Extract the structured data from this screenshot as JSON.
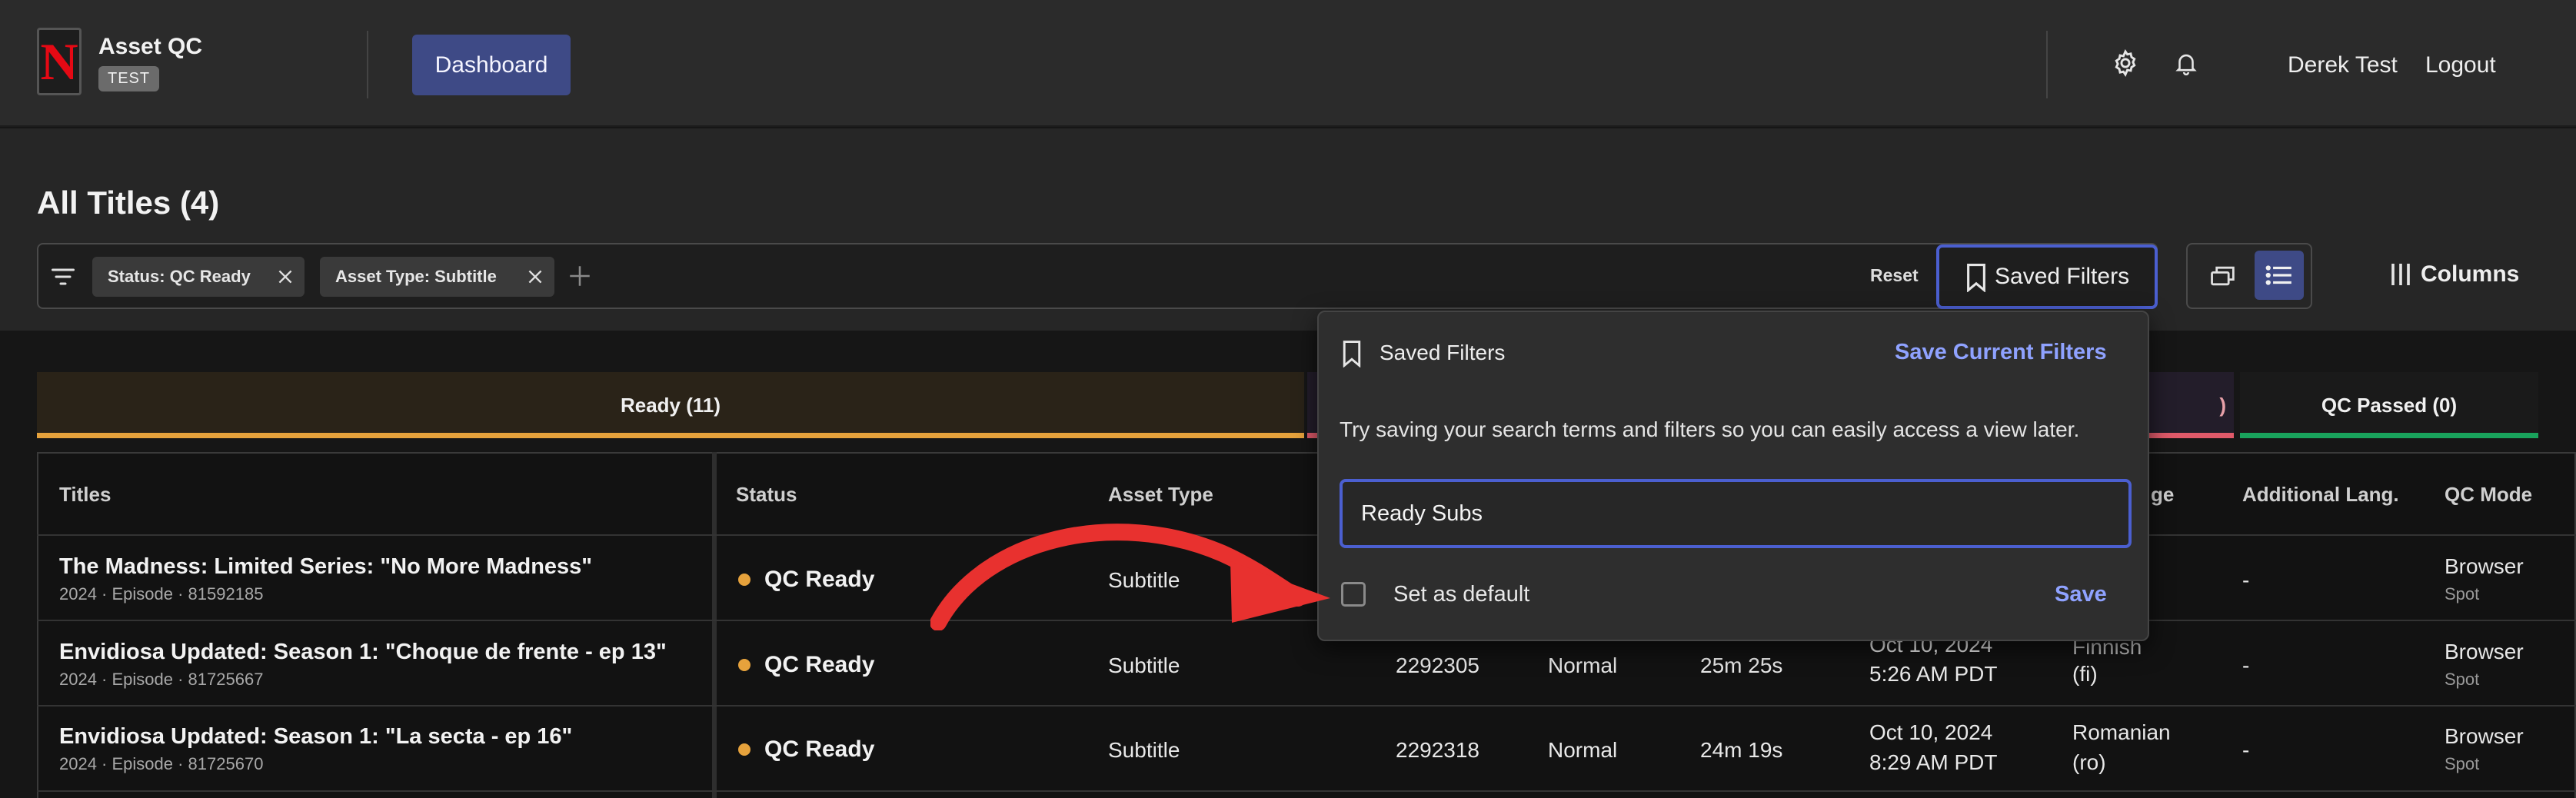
{
  "app": {
    "title": "Asset QC",
    "env_badge": "TEST",
    "logo_letter": "N",
    "brand_color": "#e50914"
  },
  "nav": {
    "dashboard_label": "Dashboard",
    "user_name": "Derek Test",
    "logout_label": "Logout",
    "icons": [
      "gear-icon",
      "bell-icon"
    ]
  },
  "page": {
    "title": "All Titles (4)"
  },
  "filters": {
    "chips": [
      {
        "label": "Status: QC Ready"
      },
      {
        "label": "Asset Type: Subtitle"
      }
    ],
    "reset_label": "Reset",
    "saved_filters_label": "Saved Filters",
    "columns_label": "Columns"
  },
  "status_tabs": [
    {
      "label": "Ready (11)",
      "color": "#e6a23c"
    },
    {
      "label": ")",
      "color": "#e05a6a"
    },
    {
      "label": "QC Passed (0)",
      "color": "#19a35c"
    }
  ],
  "table": {
    "headers": [
      "Titles",
      "Status",
      "Asset Type",
      "ge",
      "Additional Lang.",
      "QC Mode"
    ],
    "rows": [
      {
        "title": "The Madness: Limited Series: \"No More Madness\"",
        "meta": "2024 · Episode · 81592185",
        "status": "QC Ready",
        "asset_type": "Subtitle",
        "id": "",
        "priority": "",
        "duration": "",
        "date": "",
        "time": "",
        "language": "",
        "language_code": "",
        "additional_lang": "-",
        "qc_mode": "Browser",
        "qc_mode_sub": "Spot"
      },
      {
        "title": "Envidiosa Updated: Season 1: \"Choque de frente - ep 13\"",
        "meta": "2024 · Episode · 81725667",
        "status": "QC Ready",
        "asset_type": "Subtitle",
        "id": "2292305",
        "priority": "Normal",
        "duration": "25m 25s",
        "date": "Oct 10, 2024",
        "time": "5:26 AM PDT",
        "language": "Finnish",
        "language_code": "(fi)",
        "additional_lang": "-",
        "qc_mode": "Browser",
        "qc_mode_sub": "Spot"
      },
      {
        "title": "Envidiosa Updated: Season 1: \"La secta - ep 16\"",
        "meta": "2024 · Episode · 81725670",
        "status": "QC Ready",
        "asset_type": "Subtitle",
        "id": "2292318",
        "priority": "Normal",
        "duration": "24m 19s",
        "date": "Oct 10, 2024",
        "time": "8:29 AM PDT",
        "language": "Romanian",
        "language_code": "(ro)",
        "additional_lang": "-",
        "qc_mode": "Browser",
        "qc_mode_sub": "Spot"
      }
    ]
  },
  "saved_filters_popover": {
    "title": "Saved Filters",
    "save_current_label": "Save Current Filters",
    "hint": "Try saving your search terms and filters so you can easily access a view later.",
    "input_value": "Ready Subs",
    "set_default_label": "Set as default",
    "set_default_checked": false,
    "save_label": "Save",
    "accent_color": "#4b5fd0"
  },
  "annotation": {
    "arrow_color": "#e8312f"
  }
}
